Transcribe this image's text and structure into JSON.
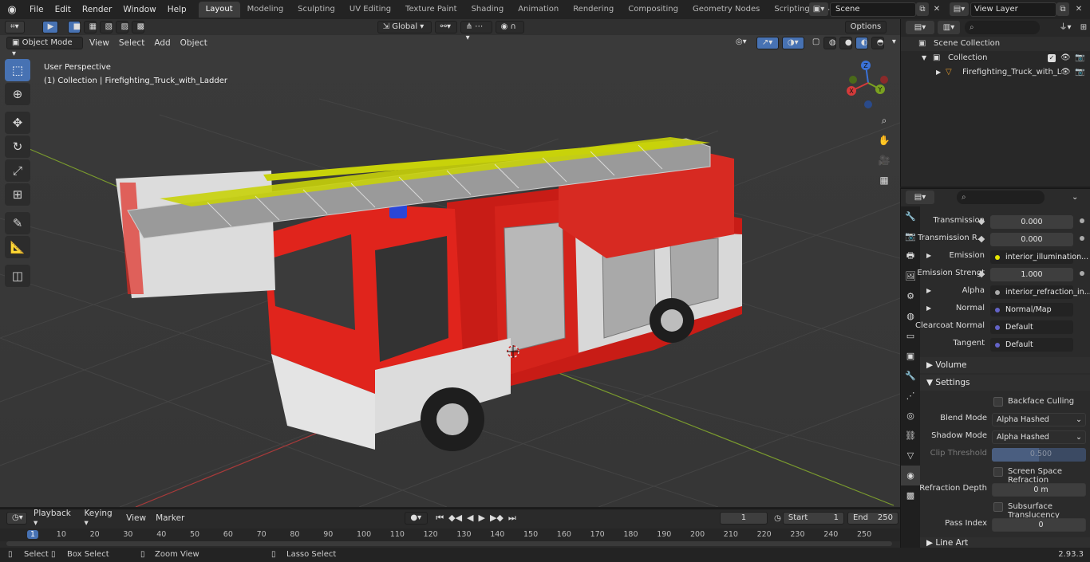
{
  "app": {
    "menu": [
      "File",
      "Edit",
      "Render",
      "Window",
      "Help"
    ],
    "version": "2.93.3"
  },
  "workspaces": [
    "Layout",
    "Modeling",
    "Sculpting",
    "UV Editing",
    "Texture Paint",
    "Shading",
    "Animation",
    "Rendering",
    "Compositing",
    "Geometry Nodes",
    "Scripting"
  ],
  "scene": {
    "name": "Scene",
    "view_layer": "View Layer"
  },
  "viewport": {
    "mode": "Object Mode",
    "menus": [
      "View",
      "Select",
      "Add",
      "Object"
    ],
    "orientation": "Global",
    "options": "Options",
    "perspective": "User Perspective",
    "collection_info": "(1) Collection | Firefighting_Truck_with_Ladder"
  },
  "outliner": {
    "scene_collection": "Scene Collection",
    "collection": "Collection",
    "object": "Firefighting_Truck_with_L"
  },
  "properties": {
    "rows": [
      {
        "label": "Transmission",
        "value": "0.000"
      },
      {
        "label": "Transmission R...",
        "value": "0.000"
      },
      {
        "label": "Emission",
        "value": "interior_illumination..."
      },
      {
        "label": "Emission Strengt",
        "value": "1.000"
      },
      {
        "label": "Alpha",
        "value": "interior_refraction_in..."
      },
      {
        "label": "Normal",
        "value": "Normal/Map"
      },
      {
        "label": "Clearcoat Normal",
        "value": "Default"
      },
      {
        "label": "Tangent",
        "value": "Default"
      }
    ],
    "volume": "Volume",
    "settings": "Settings",
    "backface": "Backface Culling",
    "blend_label": "Blend Mode",
    "blend_value": "Alpha Hashed",
    "shadow_label": "Shadow Mode",
    "shadow_value": "Alpha Hashed",
    "clip_label": "Clip Threshold",
    "clip_value": "0.500",
    "ssr": "Screen Space Refraction",
    "refr_label": "Refraction Depth",
    "refr_value": "0 m",
    "sss": "Subsurface Translucency",
    "pass_label": "Pass Index",
    "pass_value": "0",
    "line_art": "Line Art"
  },
  "timeline": {
    "menus": [
      "Playback",
      "Keying",
      "View",
      "Marker"
    ],
    "current_frame": "1",
    "start_label": "Start",
    "start": "1",
    "end_label": "End",
    "end": "250",
    "ruler": [
      "1",
      "10",
      "20",
      "30",
      "40",
      "50",
      "60",
      "70",
      "80",
      "90",
      "100",
      "110",
      "120",
      "130",
      "140",
      "150",
      "160",
      "170",
      "180",
      "190",
      "200",
      "210",
      "220",
      "230",
      "240",
      "250"
    ]
  },
  "status": {
    "select": "Select",
    "box_select": "Box Select",
    "zoom_view": "Zoom View",
    "lasso_select": "Lasso Select"
  },
  "gizmo": {
    "x": "X",
    "y": "Y",
    "z": "Z"
  },
  "colors": {
    "accent": "#4772b3",
    "truck_red": "#e0241c",
    "ladder_yellow": "#c8d20a"
  }
}
